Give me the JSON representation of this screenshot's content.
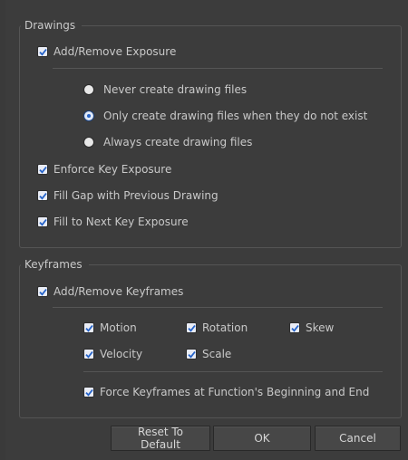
{
  "drawings": {
    "title": "Drawings",
    "add_remove_exposure": "Add/Remove Exposure",
    "radio_never": "Never create drawing files",
    "radio_only": "Only create drawing files when they do not exist",
    "radio_always": "Always create drawing files",
    "selected_option": "Only create drawing files when they do not exist",
    "enforce_key_exposure": "Enforce Key Exposure",
    "fill_gap": "Fill Gap with Previous Drawing",
    "fill_next": "Fill to Next Key Exposure"
  },
  "keyframes": {
    "title": "Keyframes",
    "add_remove_keyframes": "Add/Remove Keyframes",
    "motion": "Motion",
    "rotation": "Rotation",
    "skew": "Skew",
    "velocity": "Velocity",
    "scale": "Scale",
    "force_keyframes": "Force Keyframes at Function's Beginning and End"
  },
  "buttons": {
    "reset": "Reset To Default",
    "ok": "OK",
    "cancel": "Cancel"
  },
  "colors": {
    "background": "#3c3c3c",
    "checkmark": "#2563c9",
    "text": "#c9c9c9"
  }
}
